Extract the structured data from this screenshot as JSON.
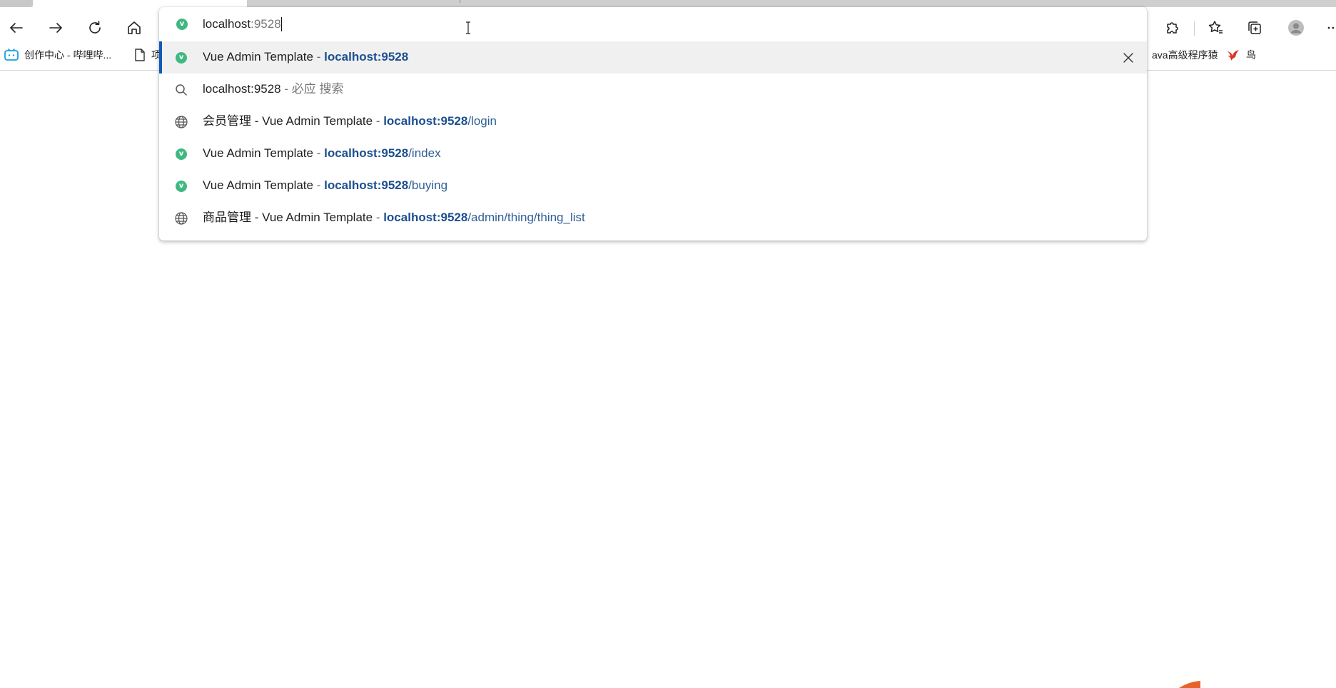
{
  "omnibox": {
    "typed": "localhost",
    "autocomplete_hint": ":9528"
  },
  "bookmarks": {
    "items": [
      {
        "label": "创作中心 - 哔哩哔...",
        "icon": "bilibili-icon"
      },
      {
        "label": "项",
        "icon": "page-icon"
      },
      {
        "label": "ava高级程序猿",
        "icon": "none"
      },
      {
        "label": "鸟",
        "icon": "bird-icon"
      }
    ]
  },
  "suggestions": [
    {
      "icon": "vue-favicon-icon",
      "title": "Vue Admin Template",
      "sep": " - ",
      "url_bold": "localhost:9528",
      "url_rest": "",
      "selected": true
    },
    {
      "icon": "search-icon",
      "title": "localhost:9528",
      "sep": " - ",
      "search_engine": "必应 搜索"
    },
    {
      "icon": "globe-icon",
      "title": "会员管理 - Vue Admin Template",
      "sep": " - ",
      "url_bold": "localhost:9528",
      "url_rest": "/login"
    },
    {
      "icon": "vue-favicon-icon",
      "title": "Vue Admin Template",
      "sep": " - ",
      "url_bold": "localhost:9528",
      "url_rest": "/index"
    },
    {
      "icon": "vue-favicon-icon",
      "title": "Vue Admin Template",
      "sep": " - ",
      "url_bold": "localhost:9528",
      "url_rest": "/buying"
    },
    {
      "icon": "globe-icon",
      "title": "商品管理 - Vue Admin Template",
      "sep": " - ",
      "url_bold": "localhost:9528",
      "url_rest": "/admin/thing/thing_list"
    }
  ],
  "favicon_letter": "v",
  "colors": {
    "accent": "#0f5ab8",
    "url": "#1c4f8f",
    "vue_green": "#41b883"
  }
}
